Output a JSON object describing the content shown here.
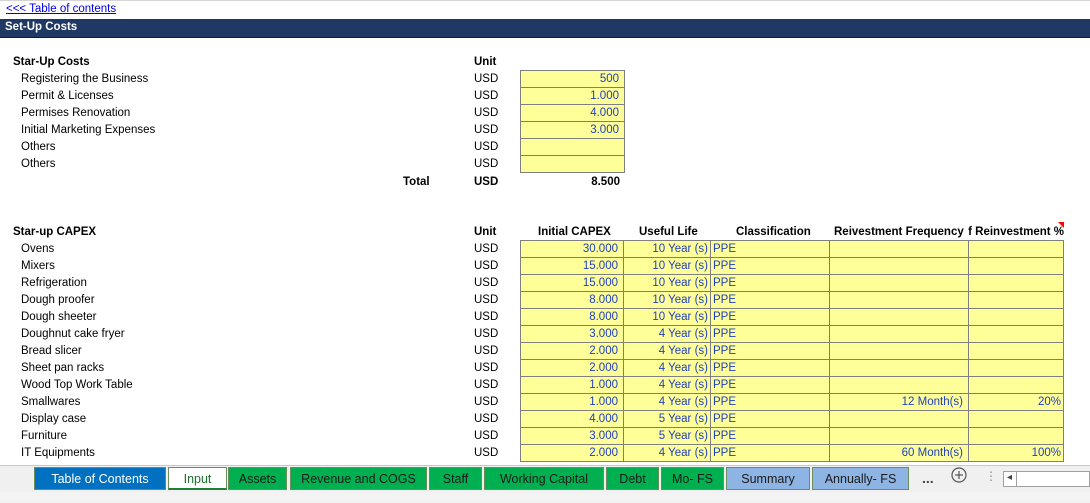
{
  "toc_link": "<<< Table of contents",
  "section_title": "Set-Up Costs",
  "startup": {
    "heading": "Star-Up Costs",
    "unit_header": "Unit",
    "items": [
      {
        "label": "Registering the Business",
        "unit": "USD",
        "value": "500"
      },
      {
        "label": "Permit & Licenses",
        "unit": "USD",
        "value": "1.000"
      },
      {
        "label": "Permises Renovation",
        "unit": "USD",
        "value": "4.000"
      },
      {
        "label": "Initial Marketing Expenses",
        "unit": "USD",
        "value": "3.000"
      },
      {
        "label": "Others",
        "unit": "USD",
        "value": ""
      },
      {
        "label": "Others",
        "unit": "USD",
        "value": ""
      }
    ],
    "total_label": "Total",
    "total_unit": "USD",
    "total_value": "8.500"
  },
  "capex": {
    "heading": "Star-up CAPEX",
    "headers": {
      "unit": "Unit",
      "initial": "Initial CAPEX",
      "life": "Useful Life",
      "classification": "Classification",
      "freq": "Reivestment Frequency",
      "pct": "% of Reinvestment"
    },
    "rows": [
      {
        "label": "Ovens",
        "unit": "USD",
        "initial": "30.000",
        "life": "10 Year (s)",
        "cls": "PPE",
        "freq": "",
        "pct": ""
      },
      {
        "label": "Mixers",
        "unit": "USD",
        "initial": "15.000",
        "life": "10 Year (s)",
        "cls": "PPE",
        "freq": "",
        "pct": ""
      },
      {
        "label": "Refrigeration",
        "unit": "USD",
        "initial": "15.000",
        "life": "10 Year (s)",
        "cls": "PPE",
        "freq": "",
        "pct": ""
      },
      {
        "label": "Dough proofer",
        "unit": "USD",
        "initial": "8.000",
        "life": "10 Year (s)",
        "cls": "PPE",
        "freq": "",
        "pct": ""
      },
      {
        "label": "Dough sheeter",
        "unit": "USD",
        "initial": "8.000",
        "life": "10 Year (s)",
        "cls": "PPE",
        "freq": "",
        "pct": ""
      },
      {
        "label": "Doughnut cake fryer",
        "unit": "USD",
        "initial": "3.000",
        "life": "4 Year (s)",
        "cls": "PPE",
        "freq": "",
        "pct": ""
      },
      {
        "label": "Bread slicer",
        "unit": "USD",
        "initial": "2.000",
        "life": "4 Year (s)",
        "cls": "PPE",
        "freq": "",
        "pct": ""
      },
      {
        "label": "Sheet pan racks",
        "unit": "USD",
        "initial": "2.000",
        "life": "4 Year (s)",
        "cls": "PPE",
        "freq": "",
        "pct": ""
      },
      {
        "label": "Wood Top Work Table",
        "unit": "USD",
        "initial": "1.000",
        "life": "4 Year (s)",
        "cls": "PPE",
        "freq": "",
        "pct": ""
      },
      {
        "label": "Smallwares",
        "unit": "USD",
        "initial": "1.000",
        "life": "4 Year (s)",
        "cls": "PPE",
        "freq": "12 Month(s)",
        "pct": "20%"
      },
      {
        "label": "Display case",
        "unit": "USD",
        "initial": "4.000",
        "life": "5 Year (s)",
        "cls": "PPE",
        "freq": "",
        "pct": ""
      },
      {
        "label": "Furniture",
        "unit": "USD",
        "initial": "3.000",
        "life": "5 Year (s)",
        "cls": "PPE",
        "freq": "",
        "pct": ""
      },
      {
        "label": "IT Equipments",
        "unit": "USD",
        "initial": "2.000",
        "life": "4 Year (s)",
        "cls": "PPE",
        "freq": "60 Month(s)",
        "pct": "100%"
      }
    ]
  },
  "tabs": [
    {
      "label": "Table of Contents",
      "style": "blue"
    },
    {
      "label": "Input",
      "style": "active"
    },
    {
      "label": "Assets",
      "style": "green"
    },
    {
      "label": "Revenue and COGS",
      "style": "green"
    },
    {
      "label": "Staff",
      "style": "green"
    },
    {
      "label": "Working Capital",
      "style": "green"
    },
    {
      "label": "Debt",
      "style": "green"
    },
    {
      "label": "Mo- FS",
      "style": "green"
    },
    {
      "label": "Summary",
      "style": "lblue"
    },
    {
      "label": "Annually- FS",
      "style": "lblue"
    }
  ],
  "tab_more": "...",
  "add_sheet_icon": "plus-circle-icon",
  "colors": {
    "header_band": "#1f3864",
    "input_fill": "#ffff99",
    "tab_green": "#00b050",
    "tab_blue": "#0070c0",
    "tab_light_blue": "#8db4e2"
  }
}
